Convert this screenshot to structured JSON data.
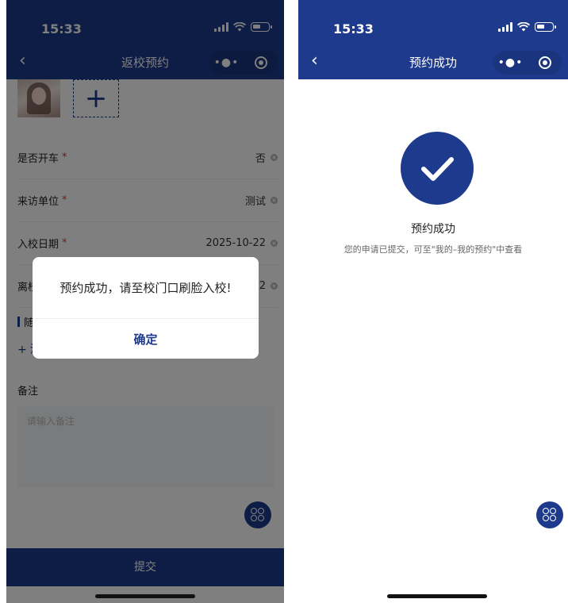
{
  "left_screen": {
    "status_bar": {
      "time": "15:33"
    },
    "nav": {
      "back_glyph": "‹",
      "title": "返校预约",
      "more_glyph": "•●•"
    },
    "photo": {
      "add_glyph": "+"
    },
    "form_rows": [
      {
        "label": "是否开车",
        "required_mark": "*",
        "value": "否"
      },
      {
        "label": "来访单位",
        "required_mark": "*",
        "value": "测试"
      },
      {
        "label": "入校日期",
        "required_mark": "*",
        "value": "2025-10-22"
      },
      {
        "label": "离校日期",
        "required_mark": "*",
        "value": "2025-10-22"
      }
    ],
    "section_title": "随行人员",
    "add_companion": "+ 添加随行人员",
    "remark_label": "备注",
    "remark_placeholder": "请输入备注",
    "submit_label": "提交",
    "dialog": {
      "message": "预约成功，请至校门口刷脸入校!",
      "confirm_label": "确定"
    }
  },
  "right_screen": {
    "status_bar": {
      "time": "15:33"
    },
    "nav": {
      "back_glyph": "‹",
      "title": "预约成功",
      "more_glyph": "•●•"
    },
    "success_title": "预约成功",
    "success_desc": "您的申请已提交，可至\"我的–我的预约\"中查看"
  },
  "colors": {
    "primary": "#1d3a8c",
    "required": "#e23c3c",
    "overlay": "rgba(0,0,0,0.5)"
  },
  "icons": [
    "back-chevron-icon",
    "more-dots-icon",
    "target-circle-icon",
    "plus-icon",
    "clear-icon",
    "clover-icon",
    "checkmark-icon",
    "signal-icon",
    "wifi-icon",
    "battery-icon"
  ]
}
